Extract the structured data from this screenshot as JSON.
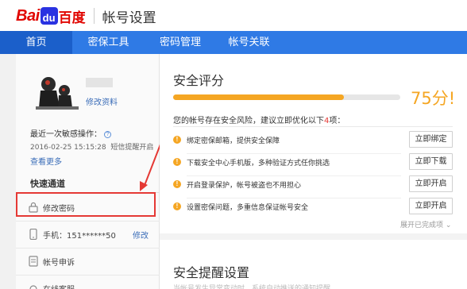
{
  "brand": {
    "logo_latin": "Bai",
    "logo_paw": "du",
    "logo_cn": "百度",
    "page_title": "帐号设置"
  },
  "nav": {
    "items": [
      {
        "label": "首页",
        "active": true
      },
      {
        "label": "密保工具",
        "active": false
      },
      {
        "label": "密码管理",
        "active": false
      },
      {
        "label": "帐号关联",
        "active": false
      }
    ]
  },
  "sidebar": {
    "edit_profile": "修改资料",
    "last_op_label": "最近一次敏感操作：",
    "last_op_time": "2016-02-25 15:15:28",
    "last_op_action": "短信提醒开启",
    "see_more": "查看更多",
    "quick_title": "快速通道",
    "items": [
      {
        "label": "修改密码",
        "icon": "lock-icon"
      },
      {
        "label": "手机：151******50",
        "icon": "phone-icon",
        "action": "修改"
      },
      {
        "label": "帐号申诉",
        "icon": "document-icon"
      },
      {
        "label": "在线客服",
        "icon": "headset-icon"
      }
    ]
  },
  "security": {
    "title": "安全评分",
    "score_percent": 75,
    "score_label": "75分!",
    "risk_prefix": "您的帐号存在安全风险，建议立即优化以下",
    "risk_count": "4",
    "risk_suffix": "项：",
    "items": [
      {
        "text": "绑定密保邮箱，提供安全保障",
        "button": "立即绑定"
      },
      {
        "text": "下载安全中心手机版，多种验证方式任你挑选",
        "button": "立即下载"
      },
      {
        "text": "开启登录保护，帐号被盗也不用担心",
        "button": "立即开启"
      },
      {
        "text": "设置密保问题，多重信息保证帐号安全",
        "button": "立即开启"
      }
    ],
    "expand": "展开已完成项 ⌄"
  },
  "reminder": {
    "title": "安全提醒设置",
    "subtitle": "当帐号发生异常变动时，系统自动推送的通知提醒"
  },
  "colors": {
    "nav_blue": "#2f7ae5",
    "brand_red": "#e10601",
    "score_orange": "#f5a623",
    "annotation_red": "#e53935"
  }
}
